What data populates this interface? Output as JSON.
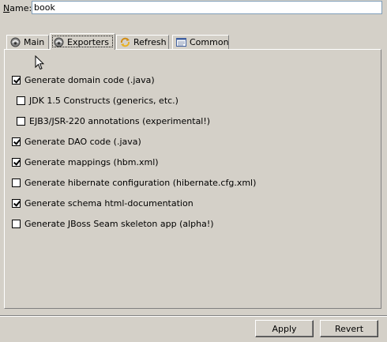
{
  "name_field": {
    "label": "Name:",
    "value": "book"
  },
  "tabs": [
    {
      "label": "Main",
      "icon": "hibernate-icon",
      "active": false
    },
    {
      "label": "Exporters",
      "icon": "hibernate-icon",
      "active": true
    },
    {
      "label": "Refresh",
      "icon": "refresh-icon",
      "active": false
    },
    {
      "label": "Common",
      "icon": "common-icon",
      "active": false
    }
  ],
  "options": [
    {
      "label": "Generate domain code (.java)",
      "checked": true
    },
    {
      "label": "JDK 1.5 Constructs (generics, etc.)",
      "checked": false
    },
    {
      "label": "EJB3/JSR-220 annotations (experimental!)",
      "checked": false
    },
    {
      "label": "Generate DAO code (.java)",
      "checked": true
    },
    {
      "label": "Generate mappings (hbm.xml)",
      "checked": true
    },
    {
      "label": "Generate hibernate configuration (hibernate.cfg.xml)",
      "checked": false
    },
    {
      "label": "Generate schema html-documentation",
      "checked": true
    },
    {
      "label": "Generate JBoss Seam skeleton app (alpha!)",
      "checked": false
    }
  ],
  "buttons": {
    "apply": "Apply",
    "revert": "Revert"
  }
}
